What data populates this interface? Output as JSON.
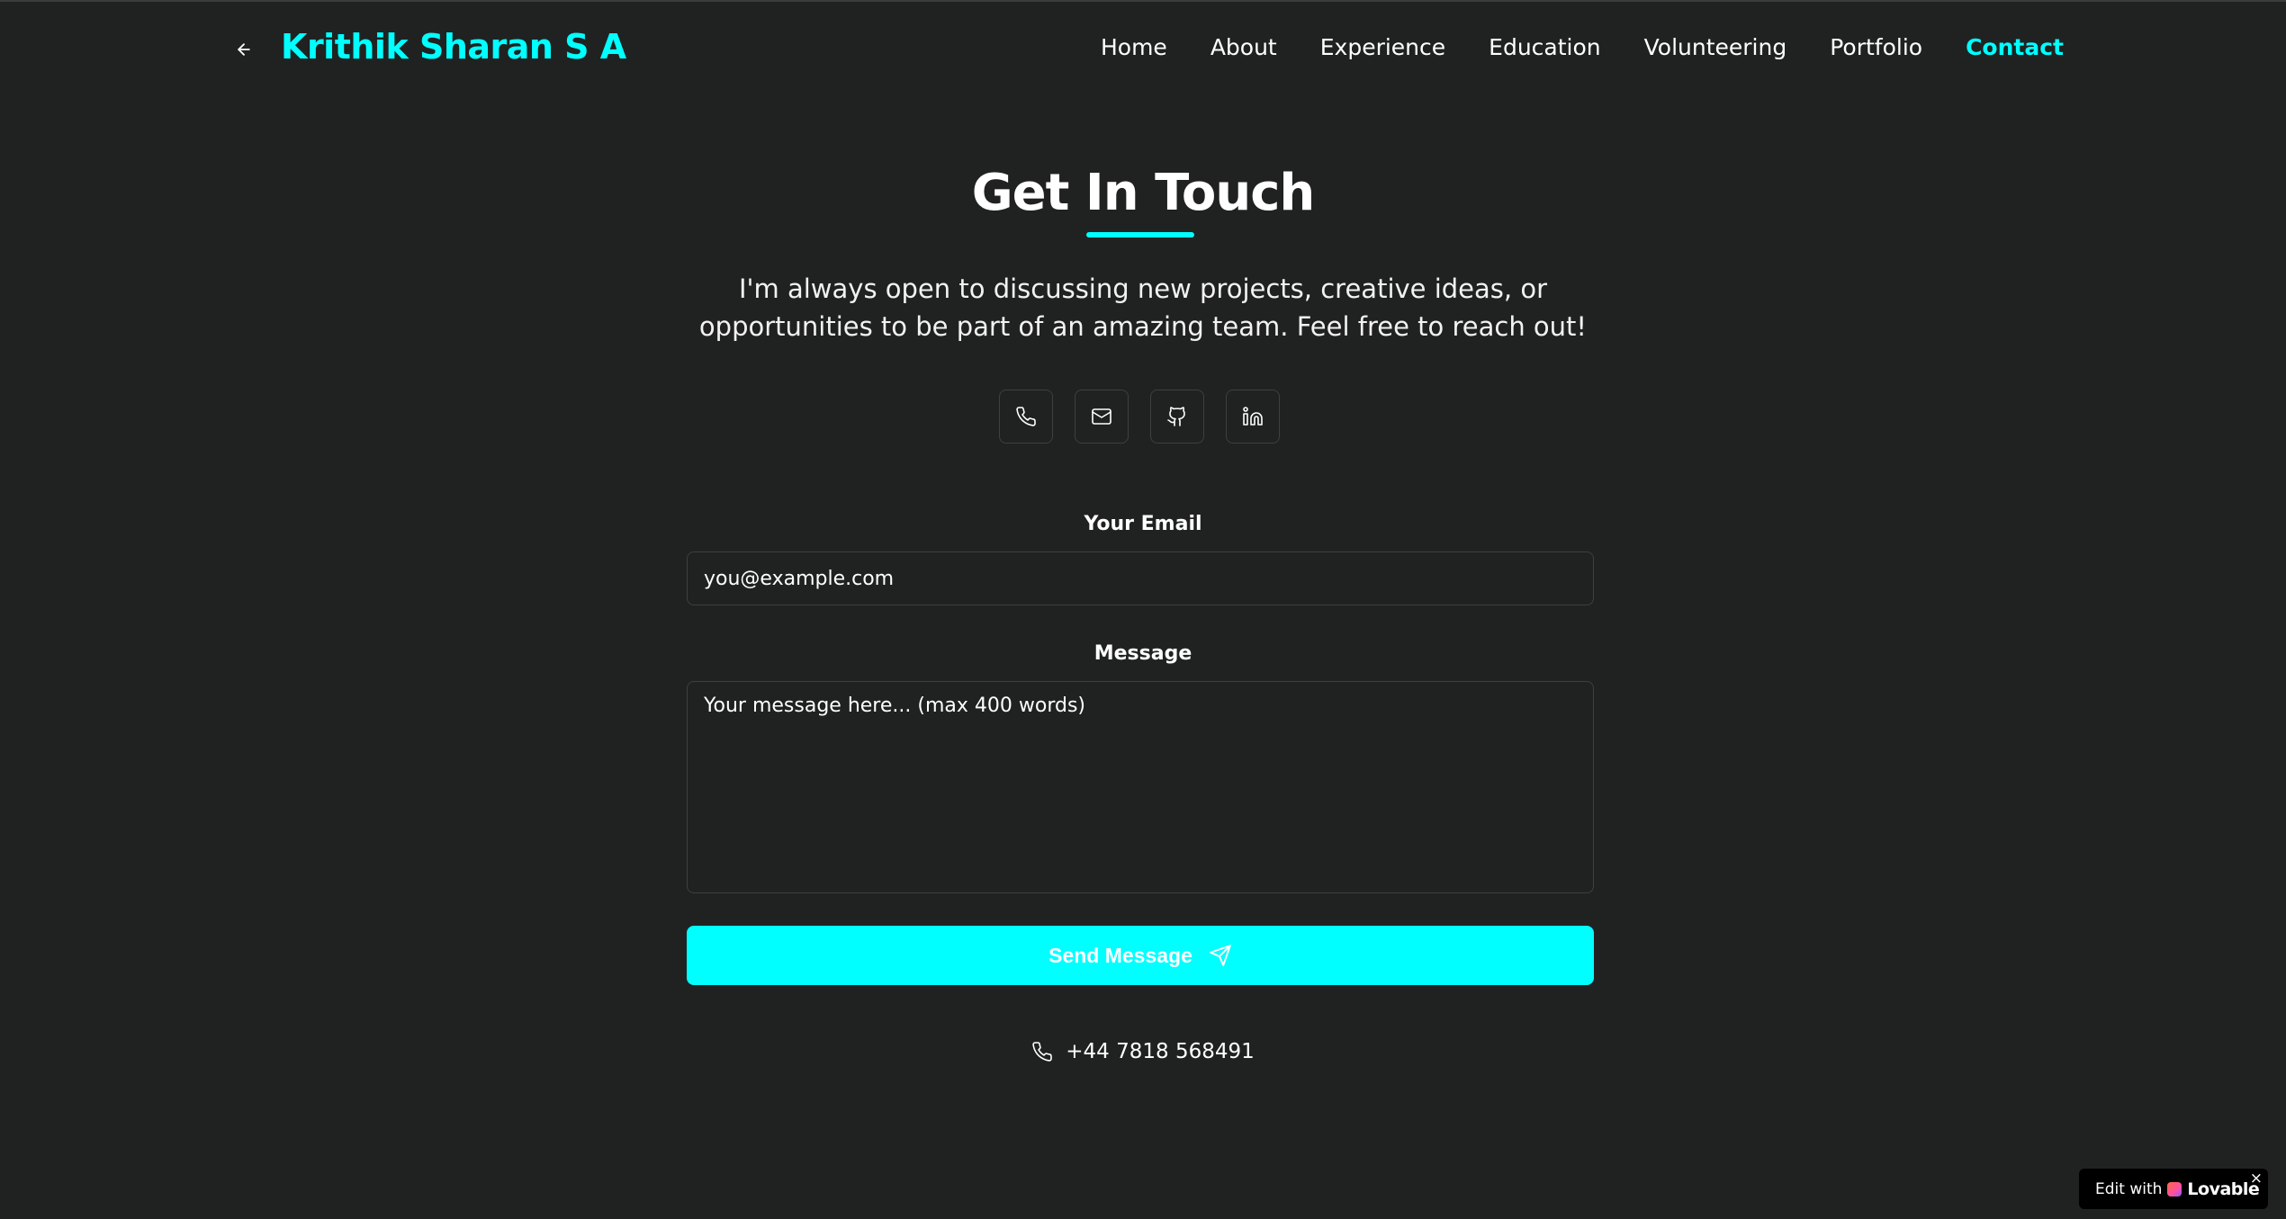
{
  "header": {
    "back_icon": "arrow-left-icon",
    "brand": "Krithik Sharan S A",
    "nav": [
      {
        "label": "Home",
        "active": false
      },
      {
        "label": "About",
        "active": false
      },
      {
        "label": "Experience",
        "active": false
      },
      {
        "label": "Education",
        "active": false
      },
      {
        "label": "Volunteering",
        "active": false
      },
      {
        "label": "Portfolio",
        "active": false
      },
      {
        "label": "Contact",
        "active": true
      }
    ]
  },
  "contact": {
    "title": "Get In Touch",
    "intro": "I'm always open to discussing new projects, creative ideas, or opportunities to be part of an amazing team. Feel free to reach out!",
    "socials": [
      "phone-icon",
      "mail-icon",
      "github-icon",
      "linkedin-icon"
    ],
    "email_label": "Your Email",
    "email_placeholder": "you@example.com",
    "message_label": "Message",
    "message_placeholder": "Your message here... (max 400 words)",
    "send_label": "Send Message",
    "send_icon": "send-icon",
    "phone_icon": "phone-icon",
    "phone": "+44 7818 568491"
  },
  "badge": {
    "text": "Edit with",
    "brand": "Lovable",
    "close": "×"
  },
  "colors": {
    "background": "#202222",
    "accent": "#00ffff",
    "text": "#ffffff",
    "border": "#3d4040"
  }
}
